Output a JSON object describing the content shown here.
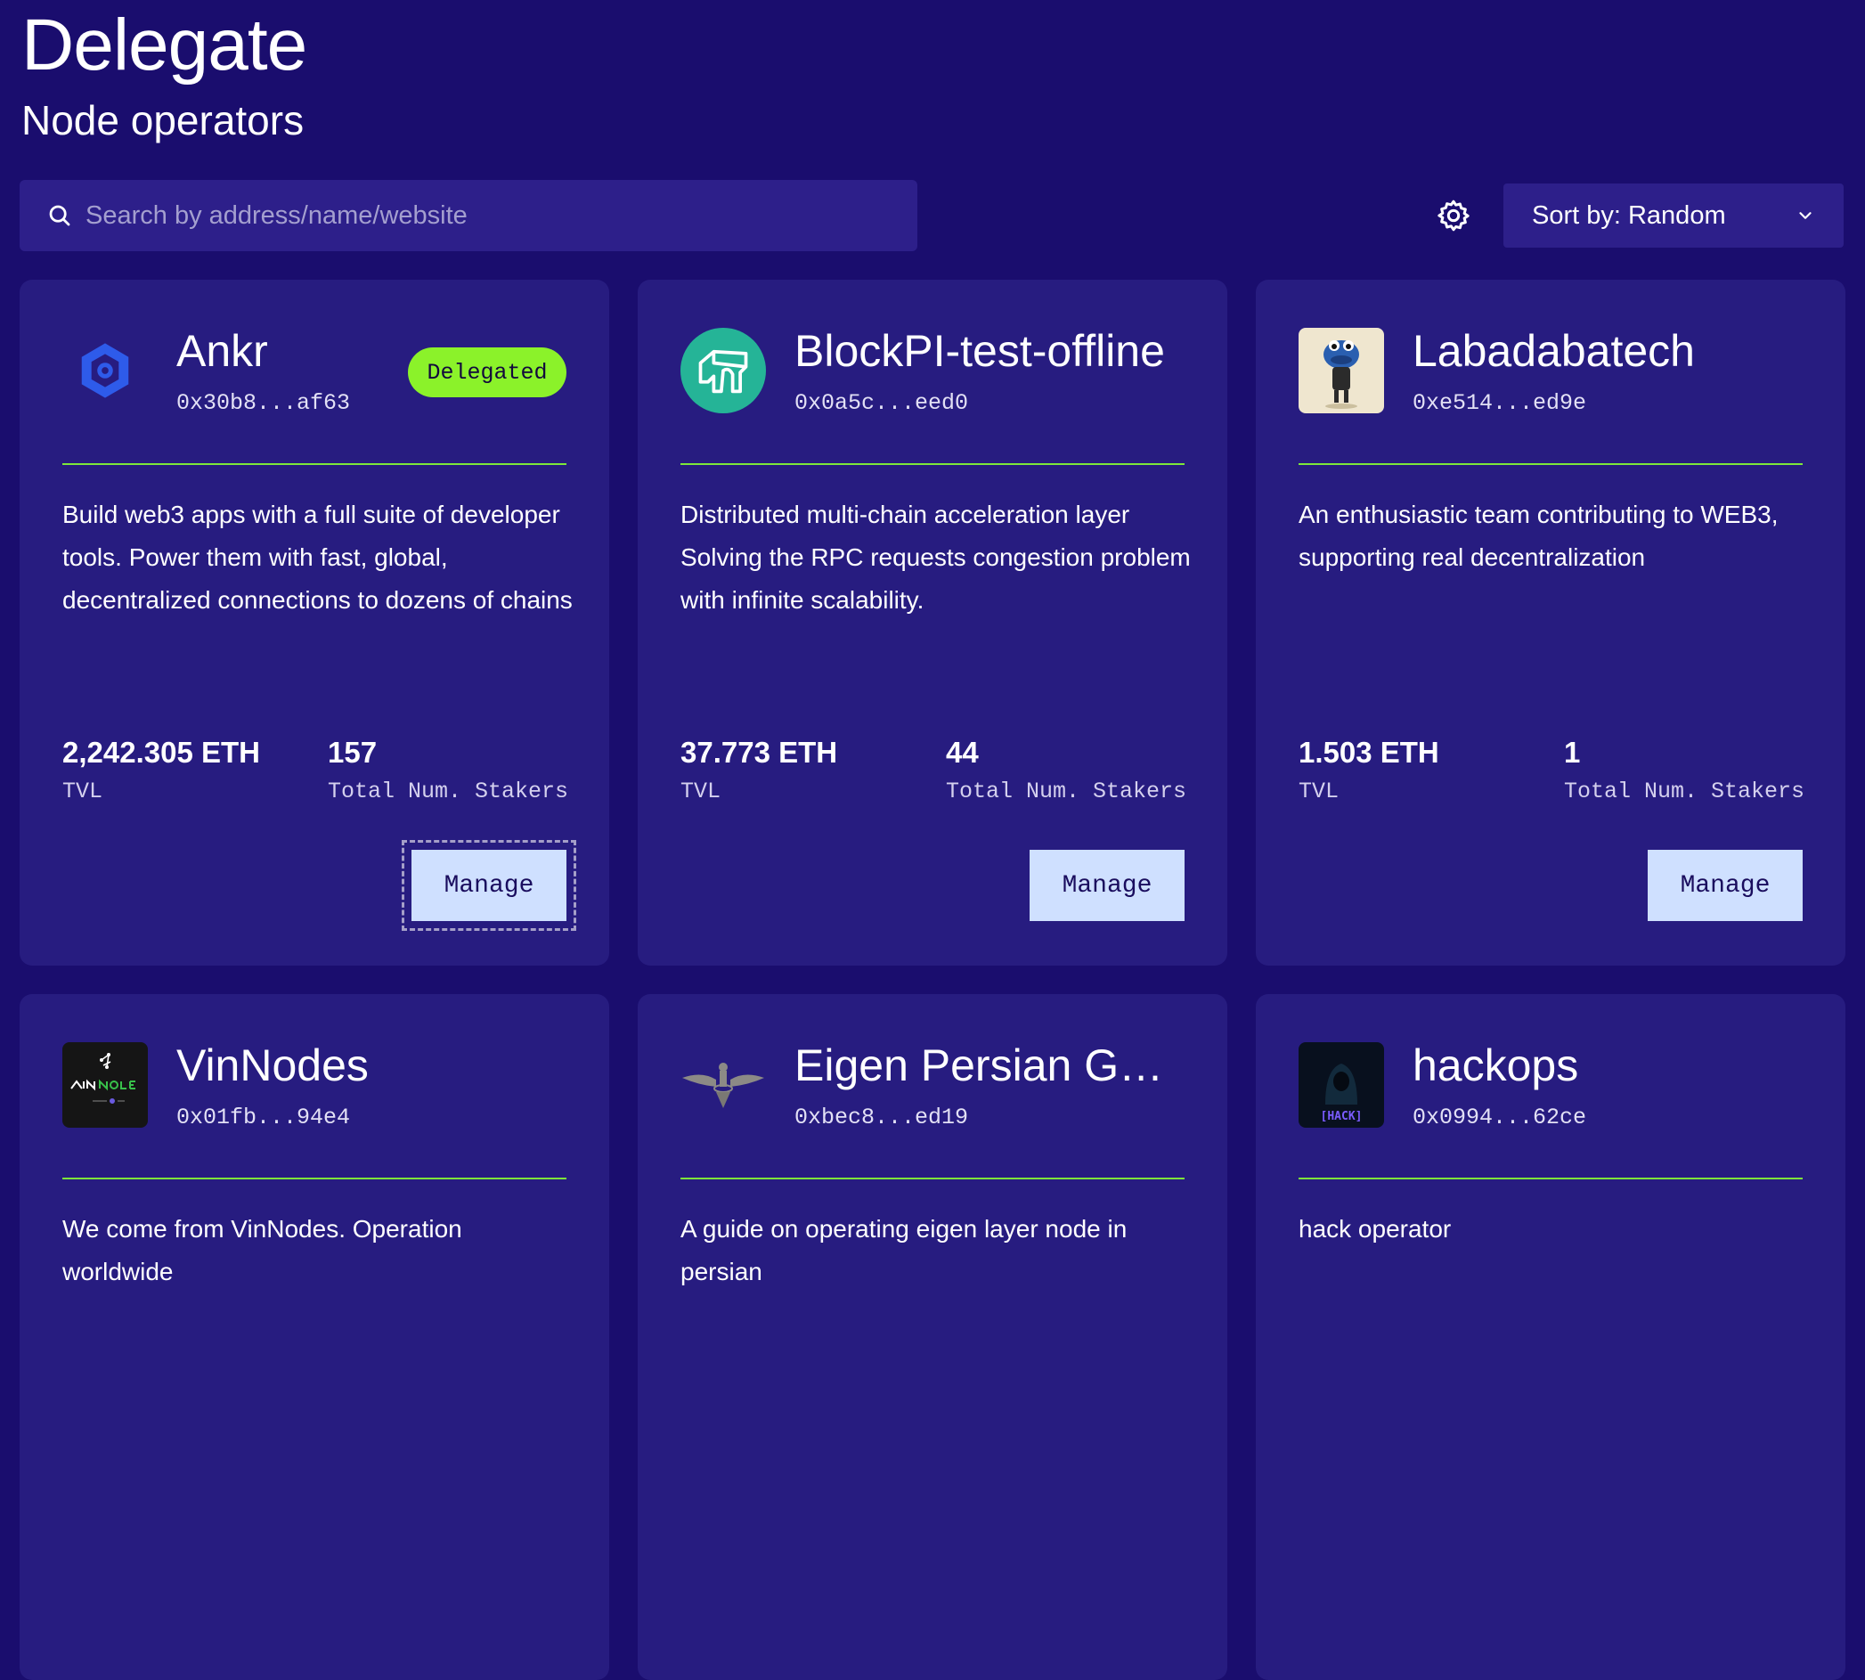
{
  "header": {
    "title": "Delegate",
    "subtitle": "Node operators"
  },
  "search": {
    "placeholder": "Search by address/name/website",
    "value": ""
  },
  "sort": {
    "label": "Sort by: Random"
  },
  "labels": {
    "tvl": "TVL",
    "stakers": "Total Num. Stakers",
    "manage": "Manage"
  },
  "operators": [
    {
      "name": "Ankr",
      "address": "0x30b8...af63",
      "badge": "Delegated",
      "description": "Build web3 apps with a full suite of developer tools. Power them with fast, global, decentralized connections to dozens of chains",
      "tvl": "2,242.305 ETH",
      "stakers": "157",
      "logo": "ankr-hexagon-logo"
    },
    {
      "name": "BlockPI-test-offline",
      "address": "0x0a5c...eed0",
      "description": "Distributed multi-chain acceleration layer Solving the RPC requests congestion problem with infinite scalability.",
      "tvl": "37.773 ETH",
      "stakers": "44",
      "logo": "blockpi-arch-logo"
    },
    {
      "name": "Labadabatech",
      "address": "0xe514...ed9e",
      "description": "An enthusiastic team contributing to WEB3, supporting real decentralization",
      "tvl": "1.503 ETH",
      "stakers": "1",
      "logo": "labadabatech-character-avatar"
    },
    {
      "name": "VinNodes",
      "address": "0x01fb...94e4",
      "description": "We come from VinNodes. Operation worldwide",
      "logo": "vinnodes-logo"
    },
    {
      "name": "Eigen Persian Gui...",
      "address": "0xbec8...ed19",
      "description": "A guide on operating eigen layer node in persian",
      "logo": "faravahar-emblem"
    },
    {
      "name": "hackops",
      "address": "0x0994...62ce",
      "description": "hack operator",
      "logo": "hackops-hooded-figure-logo"
    }
  ],
  "colors": {
    "background": "#1a0d6e",
    "card": "#271c80",
    "accent_green": "#8bf22a",
    "divider": "#7ee83a",
    "manage_button": "#cfe0ff"
  }
}
